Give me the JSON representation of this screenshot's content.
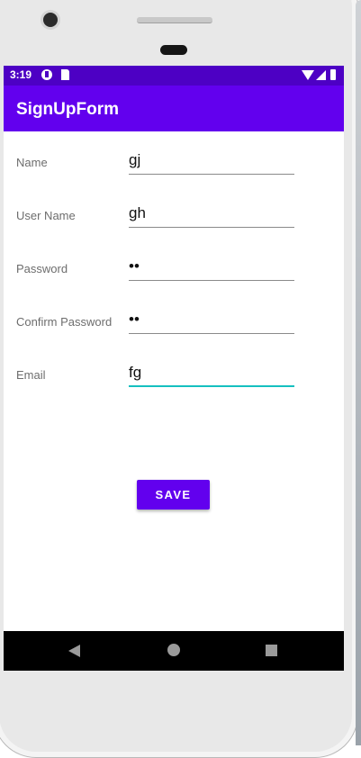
{
  "status_bar": {
    "time": "3:19"
  },
  "app_bar": {
    "title": "SignUpForm"
  },
  "form": {
    "fields": [
      {
        "label": "Name",
        "value": "gj"
      },
      {
        "label": "User Name",
        "value": "gh"
      },
      {
        "label": "Password",
        "value": "••"
      },
      {
        "label": "Confirm Password",
        "value": "••"
      },
      {
        "label": "Email",
        "value": "fg"
      }
    ],
    "save_label": "SAVE"
  },
  "colors": {
    "app_bar": "#6200ee",
    "status_bar": "#4d00c4",
    "focus_underline": "#16c0c0"
  },
  "icons": [
    "camera",
    "earpiece",
    "wifi-icon",
    "signal-icon",
    "battery-icon",
    "back-icon",
    "home-icon",
    "recents-icon"
  ]
}
